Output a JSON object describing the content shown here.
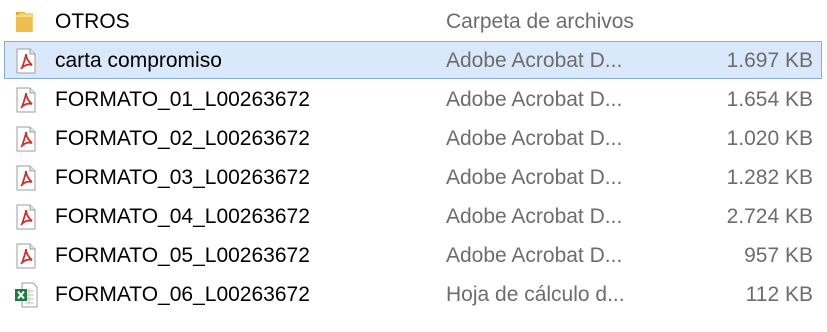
{
  "file_list": {
    "rows": [
      {
        "name": "OTROS",
        "type": "Carpeta de archivos",
        "size": "",
        "icon": "folder-icon",
        "selected": false
      },
      {
        "name": "carta compromiso",
        "type": "Adobe Acrobat D...",
        "size": "1.697 KB",
        "icon": "pdf-icon",
        "selected": true
      },
      {
        "name": "FORMATO_01_L00263672",
        "type": "Adobe Acrobat D...",
        "size": "1.654 KB",
        "icon": "pdf-icon",
        "selected": false
      },
      {
        "name": "FORMATO_02_L00263672",
        "type": "Adobe Acrobat D...",
        "size": "1.020 KB",
        "icon": "pdf-icon",
        "selected": false
      },
      {
        "name": "FORMATO_03_L00263672",
        "type": "Adobe Acrobat D...",
        "size": "1.282 KB",
        "icon": "pdf-icon",
        "selected": false
      },
      {
        "name": "FORMATO_04_L00263672",
        "type": "Adobe Acrobat D...",
        "size": "2.724 KB",
        "icon": "pdf-icon",
        "selected": false
      },
      {
        "name": "FORMATO_05_L00263672",
        "type": "Adobe Acrobat D...",
        "size": "957 KB",
        "icon": "pdf-icon",
        "selected": false
      },
      {
        "name": "FORMATO_06_L00263672",
        "type": "Hoja de cálculo d...",
        "size": "112 KB",
        "icon": "excel-icon",
        "selected": false
      }
    ]
  },
  "colors": {
    "selection_background": "#d9e8fb",
    "selection_border": "#84acdd",
    "secondary_text": "#6d6d6d"
  }
}
